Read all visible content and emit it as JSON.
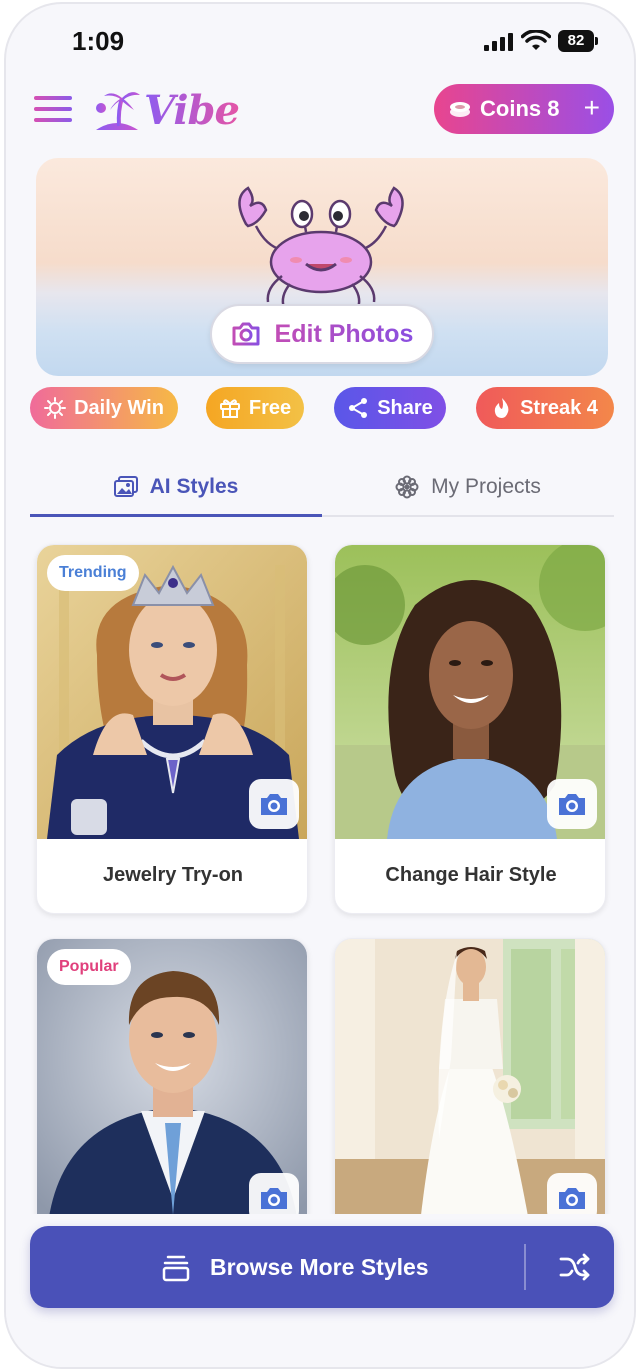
{
  "status_bar": {
    "time": "1:09",
    "battery": "82"
  },
  "header": {
    "app_name": "Vibe",
    "coins_label": "Coins 8",
    "coins_plus": "+"
  },
  "banner": {
    "edit_label": "Edit Photos"
  },
  "chips": [
    {
      "label": "Daily Win",
      "icon": "sun-icon"
    },
    {
      "label": "Free",
      "icon": "gift-icon"
    },
    {
      "label": "Share",
      "icon": "share-icon"
    },
    {
      "label": "Streak 4",
      "icon": "flame-icon"
    }
  ],
  "tabs": [
    {
      "label": "AI Styles",
      "icon": "image-icon",
      "active": true
    },
    {
      "label": "My Projects",
      "icon": "flower-icon",
      "active": false
    }
  ],
  "cards": [
    {
      "title": "Jewelry Try-on",
      "badge": "Trending"
    },
    {
      "title": "Change Hair Style",
      "badge": ""
    },
    {
      "title": "",
      "badge": "Popular"
    },
    {
      "title": "",
      "badge": ""
    }
  ],
  "bottom": {
    "browse_label": "Browse More Styles"
  },
  "colors": {
    "accent": "#4a51b8",
    "pink": "#e8458f",
    "purple": "#9a4fe6"
  }
}
